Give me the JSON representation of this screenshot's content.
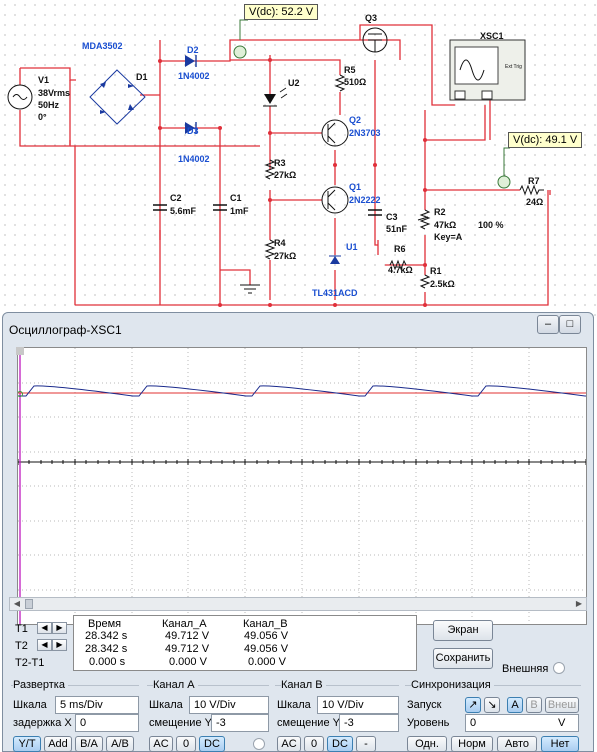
{
  "schematic": {
    "probe_top": "V(dc): 52.2 V",
    "probe_right": "V(dc): 49.1 V",
    "labels": {
      "mda": "MDA3502",
      "d1": "D1",
      "v1": "V1",
      "v1_v": "38Vrms",
      "v1_f": "50Hz",
      "v1_p": "0°",
      "d2": "D2",
      "d2_t": "1N4002",
      "d3": "D3",
      "d3_t": "1N4002",
      "c2": "C2",
      "c2_v": "5.6mF",
      "c1": "C1",
      "c1_v": "1mF",
      "u2": "U2",
      "q3": "Q3",
      "xsc": "XSC1",
      "xsc_sub": "Ext Trig",
      "r5": "R5",
      "r5_v": "510Ω",
      "q2": "Q2",
      "q2_t": "2N3703",
      "r3": "R3",
      "r3_v": "27kΩ",
      "q1": "Q1",
      "q1_t": "2N2222",
      "c3": "C3",
      "c3_v": "51nF",
      "r2": "R2",
      "r2_v": "47kΩ",
      "r2_k": "Key=A",
      "r2_p": "100 %",
      "r7": "R7",
      "r7_v": "24Ω",
      "r4": "R4",
      "r4_v": "27kΩ",
      "u1": "U1",
      "u1_t": "TL431ACD",
      "r6": "R6",
      "r6_v": "4.7kΩ",
      "r1": "R1",
      "r1_v": "2.5kΩ"
    }
  },
  "window": {
    "title": "Осциллограф-XSC1",
    "min_label": "–",
    "max_label": "□",
    "close_label": "x"
  },
  "readout": {
    "headers": [
      "Время",
      "Канал_A",
      "Канал_B"
    ],
    "rows": [
      {
        "label": "T1",
        "time": "28.342 s",
        "a": "49.712 V",
        "b": "49.056 V"
      },
      {
        "label": "T2",
        "time": "28.342 s",
        "a": "49.712 V",
        "b": "49.056 V"
      },
      {
        "label": "T2-T1",
        "time": "0.000 s",
        "a": "0.000 V",
        "b": "0.000 V"
      }
    ],
    "screen_button": "Экран",
    "save_button": "Сохранить",
    "external_label": "Внешняя"
  },
  "timebase": {
    "title": "Развертка",
    "scale_label": "Шкала",
    "scale_value": "5 ms/Div",
    "delay_label": "задержка X",
    "delay_value": "0",
    "buttons": [
      "Y/T",
      "Add",
      "B/A",
      "A/B"
    ]
  },
  "channel_a": {
    "title": "Канал A",
    "scale_label": "Шкала",
    "scale_value": "10  V/Div",
    "offset_label": "смещение Y",
    "offset_value": "-3",
    "buttons": [
      "AC",
      "0",
      "DC"
    ]
  },
  "channel_b": {
    "title": "Канал B",
    "scale_label": "Шкала",
    "scale_value": "10  V/Div",
    "offset_label": "смещение Y",
    "offset_value": "-3",
    "buttons": [
      "AC",
      "0",
      "DC",
      "-"
    ]
  },
  "trigger": {
    "title": "Синхронизация",
    "edge_label": "Запуск",
    "edge_buttons": [
      "A",
      "B",
      "Внеш"
    ],
    "level_label": "Уровень",
    "level_value": "0",
    "level_unit": "V",
    "mode_buttons": [
      "Одн.",
      "Норм",
      "Авто",
      "Нет"
    ]
  },
  "colors": {
    "wire": "#e0303a",
    "trace_a": "#1a2a8c",
    "trace_b": "#e23030",
    "cursor": "#c01ac0",
    "active_button": "#a9cdf0"
  }
}
